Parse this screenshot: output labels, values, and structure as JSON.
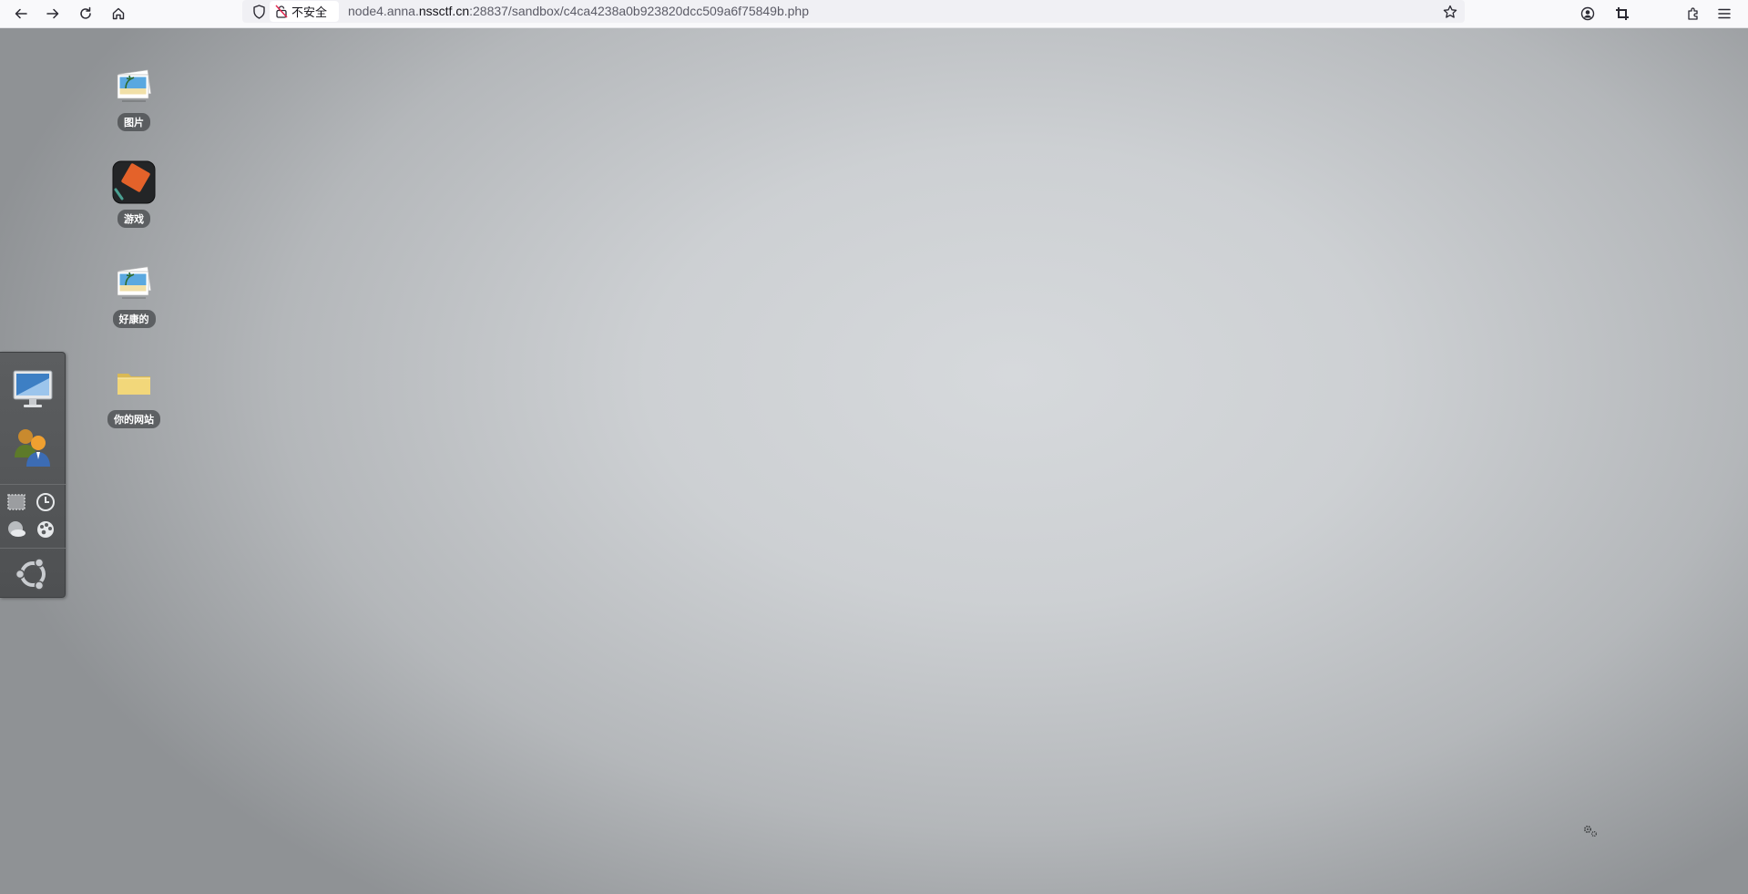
{
  "browser": {
    "security_label": "不安全",
    "url_prefix": "node4.anna.",
    "url_domain": "nssctf.cn",
    "url_suffix": ":28837/sandbox/c4ca4238a0b923820dcc509a6f75849b.php",
    "icons": {
      "back": "arrow-left-icon",
      "forward": "arrow-right-icon",
      "reload": "reload-icon",
      "home": "home-icon",
      "shield": "shield-icon",
      "insecure": "broken-lock-icon",
      "bookmark": "star-icon",
      "account": "account-icon",
      "screenshot": "crop-icon",
      "extensions": "puzzle-icon",
      "menu": "hamburger-icon"
    }
  },
  "desktop": {
    "icons": [
      {
        "label": "图片",
        "type": "photos-icon"
      },
      {
        "label": "游戏",
        "type": "game-icon"
      },
      {
        "label": "好康的",
        "type": "photos-icon"
      },
      {
        "label": "你的网站",
        "type": "folder-icon"
      }
    ]
  },
  "dock": {
    "items": [
      "computer-icon",
      "users-icon",
      "window-icon",
      "clock-icon",
      "weather-icon",
      "palette-icon",
      "ubuntu-logo-icon"
    ]
  },
  "tray": {
    "icon": "settings-gears-icon"
  },
  "colors": {
    "toolbar_bg": "#f9f9fb",
    "urlbar_bg": "#f0f0f4",
    "dock_bg": "#555759",
    "label_bg": "#4a4c4f",
    "game_orange": "#e4622a"
  }
}
